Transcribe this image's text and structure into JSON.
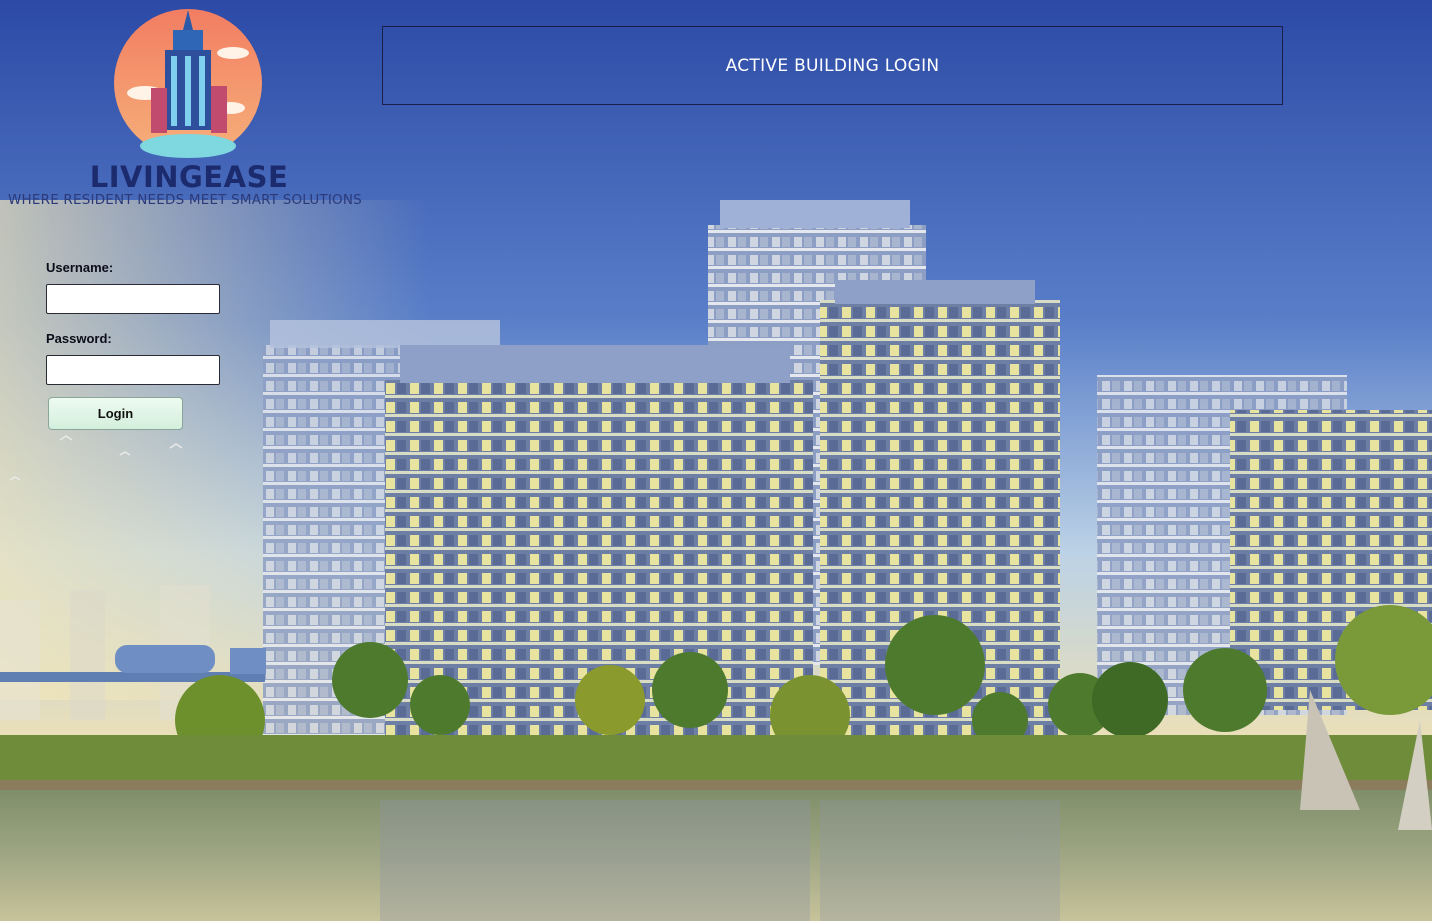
{
  "header": {
    "banner_title": "ACTIVE BUILDING LOGIN"
  },
  "branding": {
    "logo_icon": "skyscraper-logo-icon",
    "name": "LIVINGEASE",
    "tagline": "WHERE RESIDENT NEEDS MEET SMART SOLUTIONS"
  },
  "login_form": {
    "username_label": "Username:",
    "username_value": "",
    "password_label": "Password:",
    "password_value": "",
    "login_button": "Login"
  },
  "colors": {
    "sky_top": "#2f4fa8",
    "brand_text": "#1c2a6e",
    "logo_circle": "#f28c6a",
    "login_button_bg": "#dff4e4"
  }
}
